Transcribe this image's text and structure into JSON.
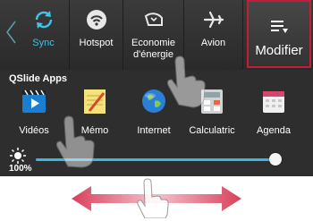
{
  "quick_settings": {
    "tiles": [
      {
        "label": "Sync",
        "icon": "sync-icon",
        "state": "active"
      },
      {
        "label": "Hotspot",
        "icon": "hotspot-icon"
      },
      {
        "label": "Economie\nd'énergie",
        "icon": "power-saving-icon"
      },
      {
        "label": "Avion",
        "icon": "airplane-icon"
      },
      {
        "label": "Modifier",
        "icon": "edit-list-icon",
        "highlighted": true
      }
    ]
  },
  "qslide": {
    "title": "QSlide Apps",
    "apps": [
      {
        "label": "Vidéos",
        "icon": "video-icon"
      },
      {
        "label": "Mémo",
        "icon": "memo-icon"
      },
      {
        "label": "Internet",
        "icon": "internet-globe-icon"
      },
      {
        "label": "Calculatric",
        "icon": "calculator-icon"
      },
      {
        "label": "Agenda",
        "icon": "calendar-icon"
      }
    ]
  },
  "brightness": {
    "percent_label": "100%",
    "level": 1.0
  },
  "colors": {
    "accent": "#3fc3e6",
    "highlight": "#c21e3a",
    "panel": "#2e2e2e"
  }
}
